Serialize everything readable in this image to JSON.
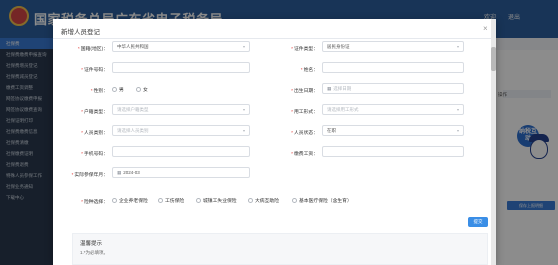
{
  "app": {
    "title": "国家税务总局广东省电子税务局",
    "user": "欢迎",
    "logout": "退出"
  },
  "sidebar": {
    "items": [
      {
        "label": "社保费"
      },
      {
        "label": "社保费缴费申报查询"
      },
      {
        "label": "社保费增员登记"
      },
      {
        "label": "社保费减员登记"
      },
      {
        "label": "缴费工资调整"
      },
      {
        "label": "网签协议缴费申报"
      },
      {
        "label": "网签协议缴费查询"
      },
      {
        "label": "社保证明打印"
      },
      {
        "label": "社保费缴费信息"
      },
      {
        "label": "社保费清缴"
      },
      {
        "label": "社保缴费证明"
      },
      {
        "label": "社保费退费"
      },
      {
        "label": "特殊人员参保工作"
      },
      {
        "label": "社保业务通知"
      },
      {
        "label": "下载中心"
      }
    ]
  },
  "background": {
    "column_label": "操作",
    "right_button": "保存上报明细"
  },
  "mascot": {
    "badge": "纳税互动"
  },
  "dialog": {
    "title": "新增人员登记",
    "close_label": "×",
    "fields": {
      "country": {
        "label": "国籍(地区)",
        "value": "中华人民共和国",
        "required": true
      },
      "id_type": {
        "label": "证件类型",
        "value": "居民身份证",
        "required": true
      },
      "id_number": {
        "label": "证件号码",
        "value": "",
        "required": true
      },
      "name": {
        "label": "姓名",
        "value": "",
        "required": true
      },
      "gender": {
        "label": "性别",
        "options": [
          "男",
          "女"
        ],
        "required": true
      },
      "birth_date": {
        "label": "出生日期",
        "placeholder": "选择日期",
        "required": true
      },
      "hukou_type": {
        "label": "户籍类型",
        "placeholder": "请选择户籍类型",
        "required": true
      },
      "employment_form": {
        "label": "用工形式",
        "placeholder": "请选择用工形式",
        "required": true
      },
      "person_category": {
        "label": "人员类别",
        "placeholder": "请选择人员类别",
        "required": true
      },
      "person_status": {
        "label": "人员状态",
        "value": "在职",
        "required": true
      },
      "mobile": {
        "label": "手机号码",
        "value": "",
        "required": true
      },
      "salary": {
        "label": "缴费工资",
        "value": "",
        "required": true
      },
      "start_month": {
        "label": "实际参保年月",
        "value": "2024-03",
        "required": true
      },
      "insurance": {
        "label": "险种选择",
        "required": true,
        "options": [
          "企业养老保险",
          "工伤保险",
          "城镇工失业保险",
          "大病互助险",
          "基本医疗保险（含生育）"
        ]
      }
    },
    "confirm_label": "提交",
    "tips": {
      "title": "温馨提示",
      "text": "1.*为必填项。"
    }
  }
}
